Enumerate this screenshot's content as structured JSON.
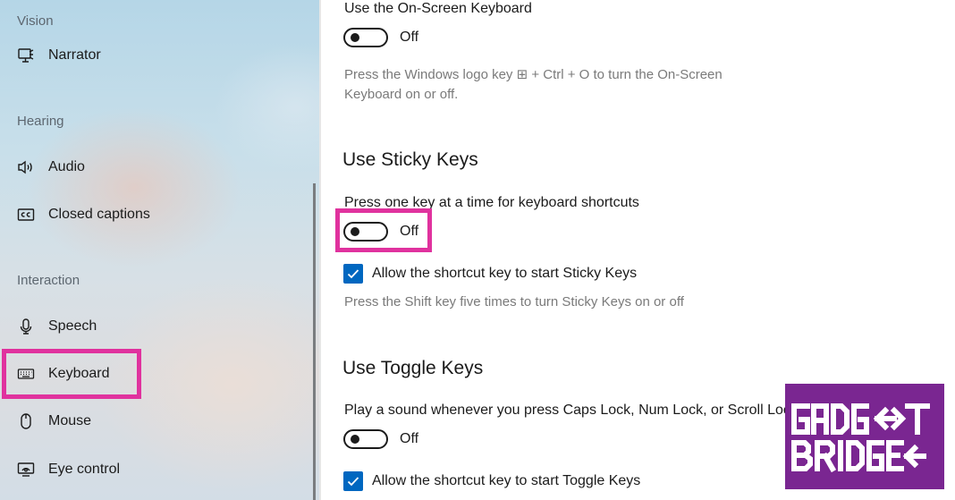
{
  "sidebar": {
    "sections": {
      "vision": "Vision",
      "hearing": "Hearing",
      "interaction": "Interaction"
    },
    "items": [
      {
        "label": "Narrator",
        "icon": "narrator-icon"
      },
      {
        "label": "Audio",
        "icon": "speaker-icon"
      },
      {
        "label": "Closed captions",
        "icon": "cc-icon"
      },
      {
        "label": "Speech",
        "icon": "microphone-icon"
      },
      {
        "label": "Keyboard",
        "icon": "keyboard-icon",
        "selected": true
      },
      {
        "label": "Mouse",
        "icon": "mouse-icon"
      },
      {
        "label": "Eye control",
        "icon": "eye-control-icon"
      }
    ]
  },
  "main": {
    "onscreen_keyboard": {
      "label": "Use the On-Screen Keyboard",
      "toggle_state": "Off",
      "description_line1": "Press the Windows logo key ⊞ + Ctrl + O to turn the On-Screen",
      "description_line2": "Keyboard on or off."
    },
    "sticky_keys": {
      "heading": "Use Sticky Keys",
      "label": "Press one key at a time for keyboard shortcuts",
      "toggle_state": "Off",
      "checkbox_label": "Allow the shortcut key to start Sticky Keys",
      "checkbox_checked": true,
      "description": "Press the Shift key five times to turn Sticky Keys on or off"
    },
    "toggle_keys": {
      "heading": "Use Toggle Keys",
      "label": "Play a sound whenever you press Caps Lock, Num Lock, or Scroll Lock",
      "toggle_state": "Off",
      "checkbox_label": "Allow the shortcut key to start Toggle Keys",
      "checkbox_checked": true
    }
  },
  "watermark": {
    "line1": "GADGET",
    "line2": "BRIDGE"
  },
  "colors": {
    "highlight": "#e0329e",
    "accent": "#0067c0",
    "logo_bg": "#7a2691"
  }
}
